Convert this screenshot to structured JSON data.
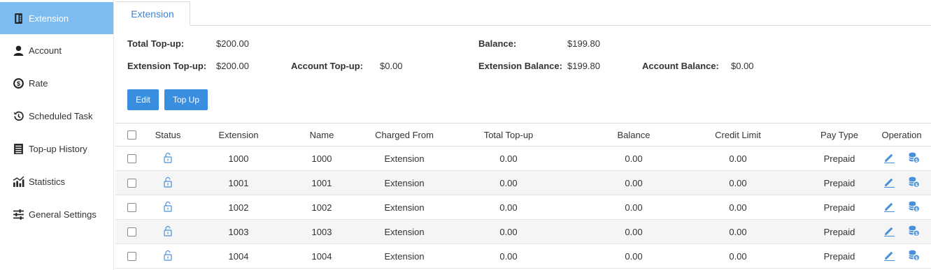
{
  "sidebar": {
    "items": [
      {
        "label": "Extension",
        "icon": "phone-book-icon"
      },
      {
        "label": "Account",
        "icon": "user-icon"
      },
      {
        "label": "Rate",
        "icon": "dollar-circle-icon"
      },
      {
        "label": "Scheduled Task",
        "icon": "history-clock-icon"
      },
      {
        "label": "Top-up History",
        "icon": "list-icon"
      },
      {
        "label": "Statistics",
        "icon": "chart-icon"
      },
      {
        "label": "General Settings",
        "icon": "sliders-icon"
      }
    ]
  },
  "tabs": {
    "active": "Extension"
  },
  "summary": {
    "total_topup_label": "Total Top-up:",
    "total_topup_value": "$200.00",
    "balance_label": "Balance:",
    "balance_value": "$199.80",
    "ext_topup_label": "Extension Top-up:",
    "ext_topup_value": "$200.00",
    "acct_topup_label": "Account Top-up:",
    "acct_topup_value": "$0.00",
    "ext_balance_label": "Extension Balance:",
    "ext_balance_value": "$199.80",
    "acct_balance_label": "Account Balance:",
    "acct_balance_value": "$0.00"
  },
  "buttons": {
    "edit": "Edit",
    "topup": "Top Up"
  },
  "table": {
    "headers": [
      "Status",
      "Extension",
      "Name",
      "Charged From",
      "Total Top-up",
      "Balance",
      "Credit Limit",
      "Pay Type",
      "Operation"
    ],
    "rows": [
      {
        "extension": "1000",
        "name": "1000",
        "charged_from": "Extension",
        "total_topup": "0.00",
        "balance": "0.00",
        "credit_limit": "0.00",
        "pay_type": "Prepaid"
      },
      {
        "extension": "1001",
        "name": "1001",
        "charged_from": "Extension",
        "total_topup": "0.00",
        "balance": "0.00",
        "credit_limit": "0.00",
        "pay_type": "Prepaid"
      },
      {
        "extension": "1002",
        "name": "1002",
        "charged_from": "Extension",
        "total_topup": "0.00",
        "balance": "0.00",
        "credit_limit": "0.00",
        "pay_type": "Prepaid"
      },
      {
        "extension": "1003",
        "name": "1003",
        "charged_from": "Extension",
        "total_topup": "0.00",
        "balance": "0.00",
        "credit_limit": "0.00",
        "pay_type": "Prepaid"
      },
      {
        "extension": "1004",
        "name": "1004",
        "charged_from": "Extension",
        "total_topup": "0.00",
        "balance": "0.00",
        "credit_limit": "0.00",
        "pay_type": "Prepaid"
      }
    ]
  },
  "colors": {
    "accent": "#3a8ee0",
    "sidebar_active": "#7cbcf0",
    "icon_blue": "#4a90d9"
  }
}
